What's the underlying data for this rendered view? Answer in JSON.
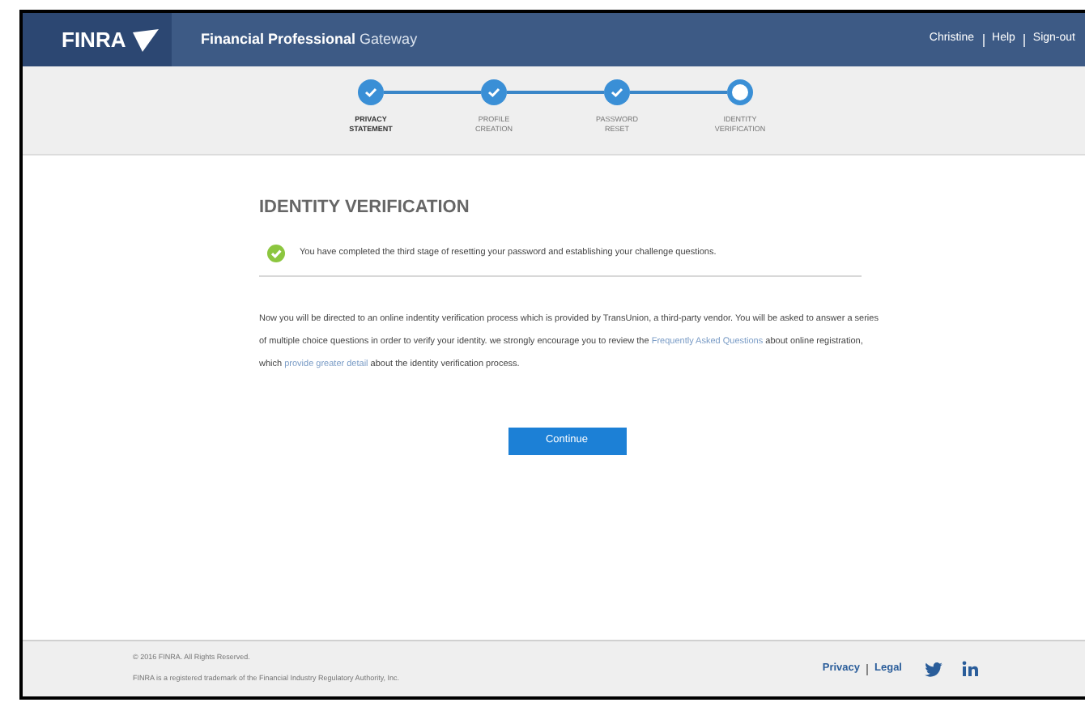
{
  "header": {
    "logo": "FINRA",
    "title_bold": "Financial Professional",
    "title_light": "Gateway",
    "user": "Christine",
    "links": [
      "Help",
      "Sign-out"
    ]
  },
  "steps": [
    {
      "label": "PRIVACY STATEMENT",
      "done": true
    },
    {
      "label": "PROFILE CREATION",
      "done": true
    },
    {
      "label": "PASSWORD RESET",
      "done": true
    },
    {
      "label": "IDENTITY VERIFICATION",
      "done": false
    }
  ],
  "heading": "IDENTITY VERIFICATION",
  "notice": "You have completed the third stage of resetting your password and establishing your challenge questions.",
  "paragraph": [
    {
      "kind": "text",
      "text": "Now you will be directed to an online indentity verification process which is provided by TransUnion, a third-party vendor. You will be asked to answer a series of multiple choice questions in order to verify your identity. we strongly encourage you to review the "
    },
    {
      "kind": "link",
      "text": "Frequently Asked Questions"
    },
    {
      "kind": "text",
      "text": " about online registration, which "
    },
    {
      "kind": "link",
      "text": "provide greater detail"
    },
    {
      "kind": "text",
      "text": " about the identity verification process."
    }
  ],
  "button": "Continue",
  "footer": {
    "copyright": "© 2016 FINRA. All Rights Reserved.",
    "trademark": "FINRA is a registered trademark of the Financial Industry Regulatory Authority, Inc.",
    "links": [
      "Privacy",
      "Legal"
    ]
  }
}
